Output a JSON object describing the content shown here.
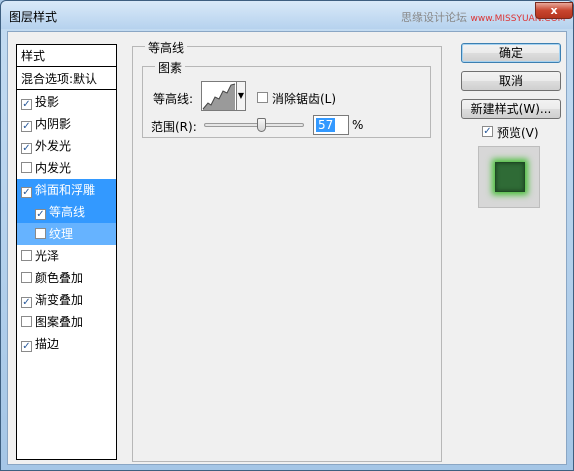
{
  "window": {
    "title": "图层样式",
    "watermark_text": "思缘设计论坛",
    "watermark_url": "www.MISSYUAN.COM",
    "close_label": "x"
  },
  "style_list": {
    "header": "样式",
    "blend_options": "混合选项:默认",
    "items": [
      {
        "label": "投影",
        "checked": true
      },
      {
        "label": "内阴影",
        "checked": true
      },
      {
        "label": "外发光",
        "checked": true
      },
      {
        "label": "内发光",
        "checked": false
      },
      {
        "label": "斜面和浮雕",
        "checked": true
      },
      {
        "label": "等高线",
        "checked": true
      },
      {
        "label": "纹理",
        "checked": false
      },
      {
        "label": "光泽",
        "checked": false
      },
      {
        "label": "颜色叠加",
        "checked": false
      },
      {
        "label": "渐变叠加",
        "checked": true
      },
      {
        "label": "图案叠加",
        "checked": false
      },
      {
        "label": "描边",
        "checked": true
      }
    ]
  },
  "contour_panel": {
    "group_title": "等高线",
    "subgroup_title": "图素",
    "contour_label": "等高线:",
    "antialias_label": "消除锯齿(L)",
    "antialias_checked": false,
    "range_label": "范围(R):",
    "range_value": "57",
    "range_unit": "%",
    "range_fraction": 0.57
  },
  "buttons": {
    "ok": "确定",
    "cancel": "取消",
    "new_style": "新建样式(W)...",
    "preview_label": "预览(V)",
    "preview_checked": true
  },
  "colors": {
    "selection": "#3399ff",
    "preview_swatch": "#2f6b36",
    "preview_glow": "#4bbf3c"
  },
  "check_glyph": "✓"
}
